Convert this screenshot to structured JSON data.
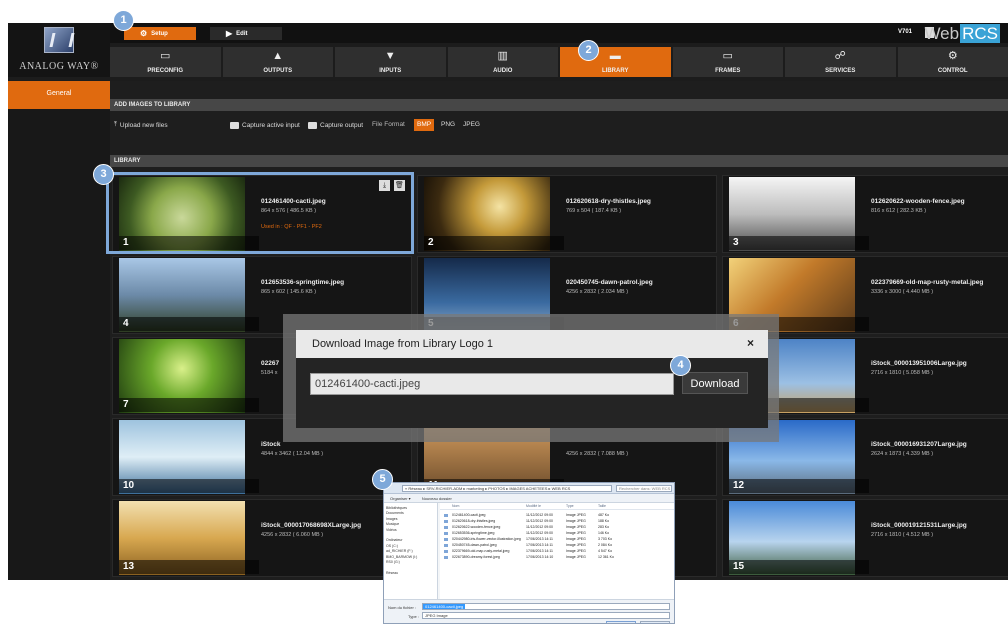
{
  "app": {
    "brand_logo_text": "ANALOG WAY",
    "brand_logo_reg": "®",
    "version": "V701",
    "web_label": "Web",
    "rcs_label": "RCS",
    "accent_color": "#e06a0f",
    "callout_color": "#7ea8d9"
  },
  "top_tabs": {
    "setup_label": "Setup",
    "setup_icon": "gear-icon",
    "edit_label": "Edit",
    "edit_icon": "play-icon"
  },
  "nav": [
    {
      "label": "PRECONFIG",
      "icon": "preconfig-icon",
      "active": false
    },
    {
      "label": "OUTPUTS",
      "icon": "outputs-icon",
      "active": false
    },
    {
      "label": "INPUTS",
      "icon": "inputs-icon",
      "active": false
    },
    {
      "label": "AUDIO",
      "icon": "audio-icon",
      "active": false
    },
    {
      "label": "LIBRARY",
      "icon": "library-icon",
      "active": true
    },
    {
      "label": "FRAMES",
      "icon": "frames-icon",
      "active": false
    },
    {
      "label": "SERVICES",
      "icon": "services-icon",
      "active": false
    },
    {
      "label": "CONTROL",
      "icon": "control-icon",
      "active": false
    }
  ],
  "sidebar": {
    "items": [
      {
        "label": "General",
        "active": true
      }
    ]
  },
  "add_section": {
    "title": "ADD IMAGES TO LIBRARY",
    "upload_label": "Upload new files",
    "capture_input_label": "Capture active input",
    "capture_output_label": "Capture output",
    "file_format_label": "File Format",
    "formats": [
      "BMP",
      "PNG",
      "JPEG"
    ],
    "selected_format": "BMP"
  },
  "library": {
    "title": "LIBRARY",
    "items": [
      {
        "num": "1",
        "name": "012461400-cacti.jpeg",
        "size": "864 x 576 ( 486.5 KB )",
        "used": "Used in : QF - PF1 - PF2"
      },
      {
        "num": "2",
        "name": "012620618-dry-thistles.jpeg",
        "size": "769 x 504 ( 187.4 KB )",
        "used": ""
      },
      {
        "num": "3",
        "name": "012620622-wooden-fence.jpeg",
        "size": "816 x 612 ( 282.3 KB )",
        "used": ""
      },
      {
        "num": "4",
        "name": "012653536-springtime.jpeg",
        "size": "865 x 602 ( 145.6 KB )",
        "used": ""
      },
      {
        "num": "5",
        "name": "020450745-dawn-patrol.jpeg",
        "size": "4256 x 2832 ( 2.034 MB )",
        "used": ""
      },
      {
        "num": "6",
        "name": "022379669-old-map-rusty-metal.jpeg",
        "size": "3336 x 3000 ( 4.440 MB )",
        "used": ""
      },
      {
        "num": "7",
        "name": "02267",
        "size": "5184 x",
        "used": ""
      },
      {
        "num": "8",
        "name": "",
        "size": "",
        "used": ""
      },
      {
        "num": "9",
        "name": "iStock_000013951006Large.jpg",
        "size": "2716 x 1810 ( 5.058 MB )",
        "used": ""
      },
      {
        "num": "10",
        "name": "iStock",
        "size": "4844 x 3462 ( 12.04 MB )",
        "used": ""
      },
      {
        "num": "11",
        "name": "",
        "size": "4256 x 2832 ( 7.088 MB )",
        "used": ""
      },
      {
        "num": "12",
        "name": "iStock_000016931207Large.jpg",
        "size": "2624 x 1873 ( 4.339 MB )",
        "used": ""
      },
      {
        "num": "13",
        "name": "iStock_000017068698XLarge.jpg",
        "size": "4256 x 2832 ( 6.060 MB )",
        "used": ""
      },
      {
        "num": "14",
        "name": "",
        "size": "",
        "used": ""
      },
      {
        "num": "15",
        "name": "iStock_000019121531Large.jpg",
        "size": "2716 x 1810 ( 4.512 MB )",
        "used": ""
      }
    ]
  },
  "modal": {
    "title": "Download Image from Library Logo 1",
    "close": "×",
    "filename": "012461400-cacti.jpeg",
    "download_label": "Download",
    "obscured_text": "020450745-dawn-patrol.jpeg"
  },
  "callouts": [
    "1",
    "2",
    "3",
    "4",
    "5"
  ],
  "file_dialog": {
    "path": "« Réseau ▸ SRV-RICHIER-ADM ▸ marketing ▸ PHOTOS ▸ IMAGES ACHETEES ▸ WEB RCS",
    "search_placeholder": "Rechercher dans: WEB RCS",
    "organize_label": "Organiser ▾",
    "new_folder_label": "Nouveau dossier",
    "tree": [
      "Bibliothèques",
      "Documents",
      "Images",
      "Musique",
      "Vidéos",
      "",
      "Ordinateur",
      "OS (C:)",
      "ad_RICHIER (F:)",
      "BMO_BARMOW (I:)",
      "RS0 (G:)",
      "",
      "Réseau"
    ],
    "columns": [
      "Nom",
      "Modifié le",
      "Type",
      "Taille"
    ],
    "rows": [
      {
        "name": "012461400-cacti.jpeg",
        "date": "11/12/2012 09:00",
        "type": "Image JPEG",
        "size": "487 Ko"
      },
      {
        "name": "012620618-dry-thistles.jpeg",
        "date": "11/12/2012 09:00",
        "type": "Image JPEG",
        "size": "188 Ko"
      },
      {
        "name": "012620622-wooden-fence.jpeg",
        "date": "11/12/2012 09:00",
        "type": "Image JPEG",
        "size": "283 Ko"
      },
      {
        "name": "012653536-springtime.jpeg",
        "date": "11/12/2012 09:00",
        "type": "Image JPEG",
        "size": "146 Ko"
      },
      {
        "name": "020442980-iris-flower-vector-illustration.jpeg",
        "date": "17/06/2013 14:11",
        "type": "Image JPEG",
        "size": "3 703 Ko"
      },
      {
        "name": "020450745-dawn-patrol.jpeg",
        "date": "17/06/2013 14:11",
        "type": "Image JPEG",
        "size": "2 084 Ko"
      },
      {
        "name": "022379669-old-map-rusty-metal.jpeg",
        "date": "17/06/2013 14:11",
        "type": "Image JPEG",
        "size": "4 547 Ko"
      },
      {
        "name": "022673890-dreamy-forest.jpeg",
        "date": "17/06/2013 14:10",
        "type": "Image JPEG",
        "size": "12 361 Ko"
      }
    ],
    "filename_label": "Nom du fichier :",
    "filetype_label": "Type :",
    "filename_value": "012461400-cacti.jpeg",
    "filetype_value": "JPEG Image"
  }
}
